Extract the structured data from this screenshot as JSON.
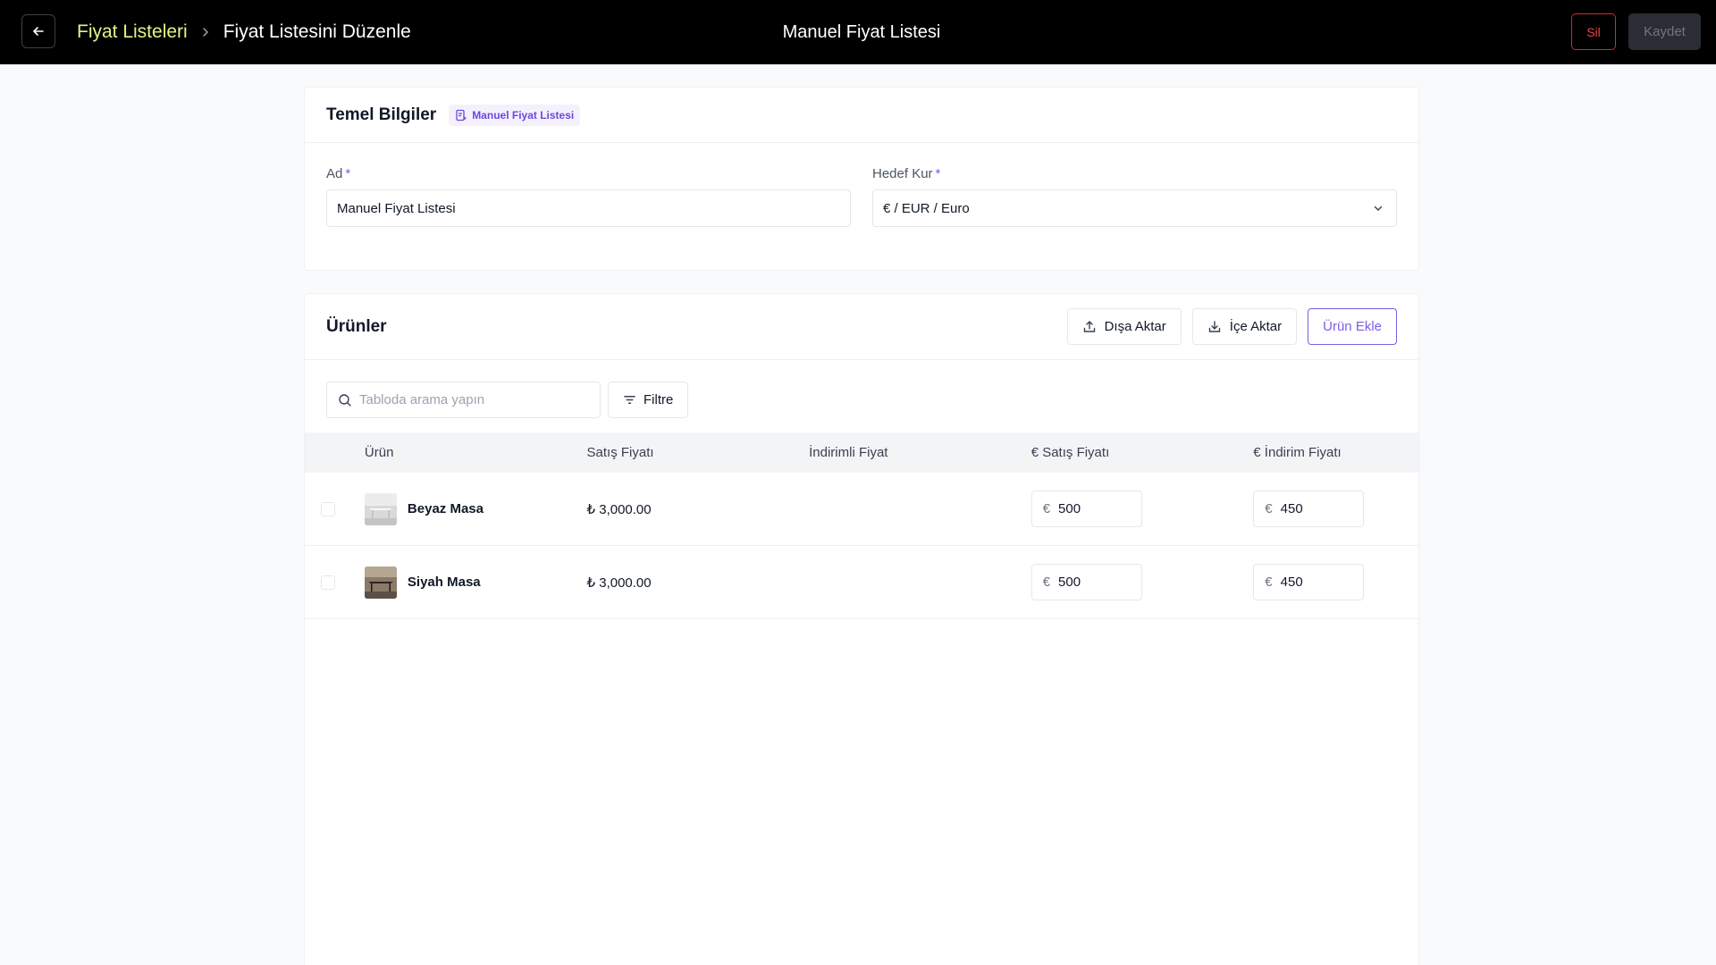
{
  "topbar": {
    "breadcrumb_parent": "Fiyat Listeleri",
    "breadcrumb_current": "Fiyat Listesini Düzenle",
    "title": "Manuel Fiyat Listesi",
    "delete_label": "Sil",
    "save_label": "Kaydet"
  },
  "basic_info": {
    "title": "Temel Bilgiler",
    "badge": "Manuel Fiyat Listesi",
    "name_label": "Ad",
    "name_value": "Manuel Fiyat Listesi",
    "currency_label": "Hedef Kur",
    "currency_value": "€ / EUR / Euro",
    "required_mark": "*"
  },
  "products": {
    "title": "Ürünler",
    "export_label": "Dışa Aktar",
    "import_label": "İçe Aktar",
    "add_label": "Ürün Ekle",
    "search_placeholder": "Tabloda arama yapın",
    "filter_label": "Filtre",
    "columns": [
      "Ürün",
      "Satış Fiyatı",
      "İndirimli Fiyat",
      "€ Satış Fiyatı",
      "€ İndirim Fiyatı"
    ],
    "rows": [
      {
        "name": "Beyaz Masa",
        "sale_price": "₺ 3,000.00",
        "discounted_price": "",
        "currency": "€",
        "eur_sale": "500",
        "eur_discount": "450"
      },
      {
        "name": "Siyah Masa",
        "sale_price": "₺ 3,000.00",
        "discounted_price": "",
        "currency": "€",
        "eur_sale": "500",
        "eur_discount": "450"
      }
    ]
  },
  "colors": {
    "accent_purple": "#7c5ce6",
    "breadcrumb_yellow": "#e5f28a",
    "danger_red": "#dc2626"
  }
}
